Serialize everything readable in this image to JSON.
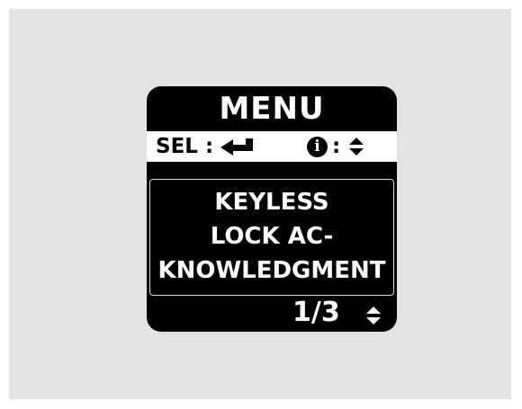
{
  "display": {
    "title": "MENU",
    "hint": {
      "select_label": "SEL",
      "select_separator": ":",
      "select_icon": "enter-arrow-icon",
      "info_icon": "info-icon",
      "info_glyph": "i",
      "info_separator": ":",
      "info_nav_icon": "up-down-arrows-icon"
    },
    "item_lines": [
      "KEYLESS",
      "LOCK AC-",
      "KNOWLEDGMENT"
    ],
    "page_indicator": "1/3",
    "page_nav_icon": "up-down-arrows-icon"
  },
  "colors": {
    "screen_background": "#000000",
    "screen_text": "#ffffff",
    "hint_bar_background": "#ffffff",
    "surround": "#e3e3e3"
  }
}
